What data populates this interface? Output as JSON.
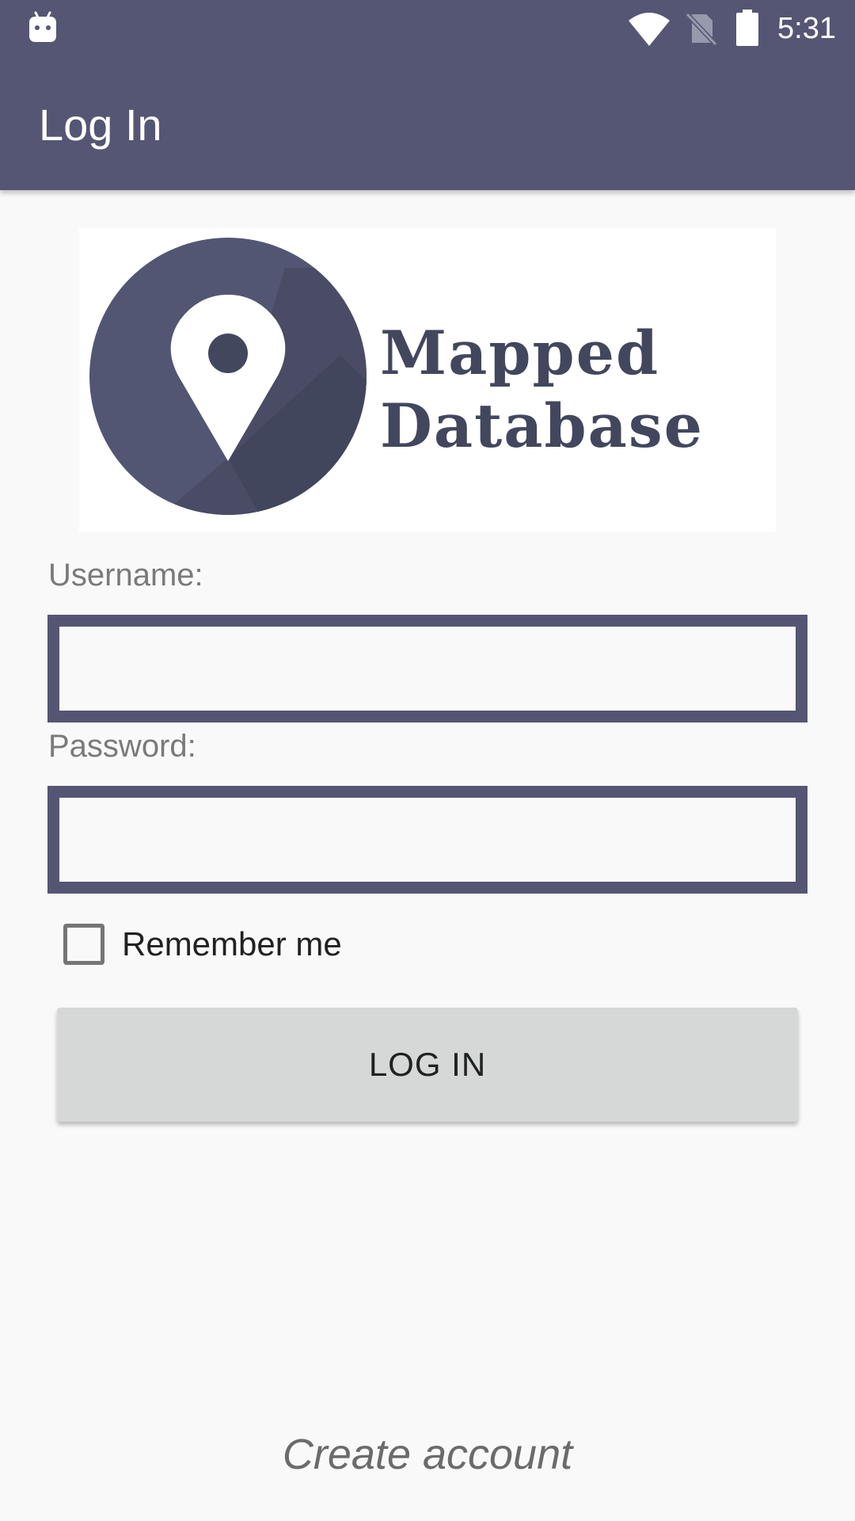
{
  "status_bar": {
    "time": "5:31",
    "icons": [
      "android-debug-icon",
      "wifi-icon",
      "no-sim-icon",
      "battery-icon"
    ]
  },
  "app_bar": {
    "title": "Log In"
  },
  "logo": {
    "line1": "Mapped",
    "line2": "Database",
    "icon": "map-pin-icon"
  },
  "form": {
    "username_label": "Username:",
    "username_value": "",
    "password_label": "Password:",
    "password_value": "",
    "remember_label": "Remember me",
    "remember_checked": false,
    "login_button_label": "LOG IN"
  },
  "footer": {
    "create_account_label": "Create account"
  },
  "colors": {
    "primary": "#545673",
    "logo_text": "#42475e",
    "background": "#f9f9f9",
    "button": "#d6d7d7"
  }
}
